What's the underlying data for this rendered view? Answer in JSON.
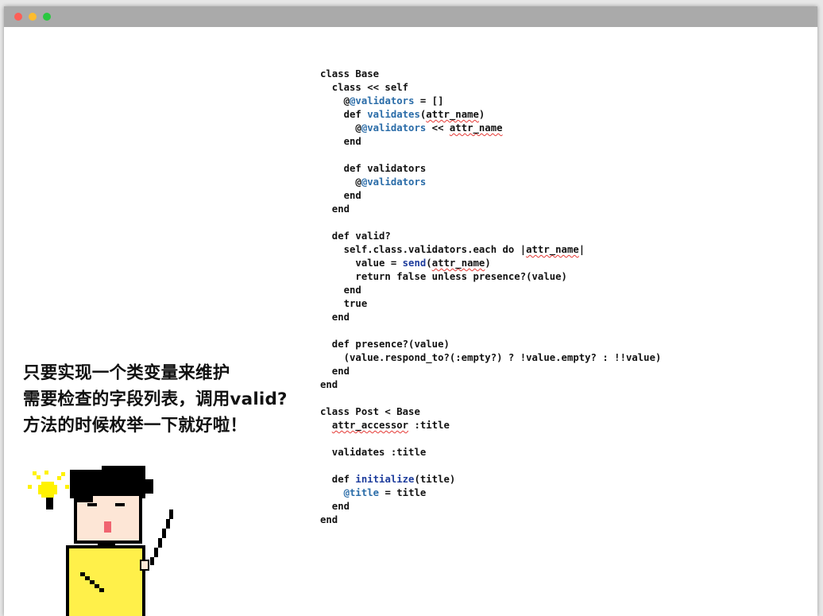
{
  "window": {
    "controls": [
      "close",
      "minimize",
      "zoom"
    ],
    "colors": {
      "titlebar": "#aaaaaa",
      "close": "#fd5f57",
      "minimize": "#fdbc2e",
      "zoom": "#2ac840"
    }
  },
  "caption": {
    "lines": [
      "只要实现一个类变量来维护",
      "需要检查的字段列表，调用valid?",
      "方法的时候枚举一下就好啦！"
    ]
  },
  "code": {
    "language": "ruby",
    "lines": [
      [
        {
          "t": "class Base"
        }
      ],
      [
        {
          "t": "  class << self"
        }
      ],
      [
        {
          "t": "    @"
        },
        {
          "t": "@validators",
          "k": "ivar"
        },
        {
          "t": " = []"
        }
      ],
      [
        {
          "t": "    def "
        },
        {
          "t": "validates",
          "k": "meth"
        },
        {
          "t": "("
        },
        {
          "t": "attr_name",
          "k": "squig"
        },
        {
          "t": ")"
        }
      ],
      [
        {
          "t": "      @"
        },
        {
          "t": "@validators",
          "k": "ivar"
        },
        {
          "t": " << "
        },
        {
          "t": "attr_name",
          "k": "squig"
        }
      ],
      [
        {
          "t": "    end"
        }
      ],
      [
        {
          "t": ""
        }
      ],
      [
        {
          "t": "    def validators"
        }
      ],
      [
        {
          "t": "      @"
        },
        {
          "t": "@validators",
          "k": "ivar"
        }
      ],
      [
        {
          "t": "    end"
        }
      ],
      [
        {
          "t": "  end"
        }
      ],
      [
        {
          "t": ""
        }
      ],
      [
        {
          "t": "  def valid?"
        }
      ],
      [
        {
          "t": "    self.class.validators.each do |"
        },
        {
          "t": "attr_name",
          "k": "squig"
        },
        {
          "t": "|"
        }
      ],
      [
        {
          "t": "      value = "
        },
        {
          "t": "send",
          "k": "builtin"
        },
        {
          "t": "("
        },
        {
          "t": "attr_name",
          "k": "squig"
        },
        {
          "t": ")"
        }
      ],
      [
        {
          "t": "      return false unless presence?(value)"
        }
      ],
      [
        {
          "t": "    end"
        }
      ],
      [
        {
          "t": "    true"
        }
      ],
      [
        {
          "t": "  end"
        }
      ],
      [
        {
          "t": ""
        }
      ],
      [
        {
          "t": "  def presence?(value)"
        }
      ],
      [
        {
          "t": "    (value.respond_to?(:empty?) ? !value.empty? : !!value)"
        }
      ],
      [
        {
          "t": "  end"
        }
      ],
      [
        {
          "t": "end"
        }
      ],
      [
        {
          "t": ""
        }
      ],
      [
        {
          "t": "class Post < Base"
        }
      ],
      [
        {
          "t": "  "
        },
        {
          "t": "attr_accessor",
          "k": "squig"
        },
        {
          "t": " :title"
        }
      ],
      [
        {
          "t": ""
        }
      ],
      [
        {
          "t": "  validates :title"
        }
      ],
      [
        {
          "t": ""
        }
      ],
      [
        {
          "t": "  def "
        },
        {
          "t": "initialize",
          "k": "builtin"
        },
        {
          "t": "(title)"
        }
      ],
      [
        {
          "t": "    "
        },
        {
          "t": "@title",
          "k": "ivar"
        },
        {
          "t": " = title"
        }
      ],
      [
        {
          "t": "  end"
        }
      ],
      [
        {
          "t": "end"
        }
      ]
    ],
    "colors": {
      "ivar": "#2a6ca8",
      "builtin": "#1d3c9c",
      "squiggle": "#e53935"
    }
  },
  "illustration": {
    "icons": [
      "lightbulb-icon",
      "pointer-stick-icon"
    ],
    "character": "pixel-art-person",
    "colors": {
      "shirt": "#fff04a",
      "skin": "#fde6d6",
      "hair": "#000000",
      "mouth": "#f06470",
      "bulb": "#fff200"
    }
  }
}
